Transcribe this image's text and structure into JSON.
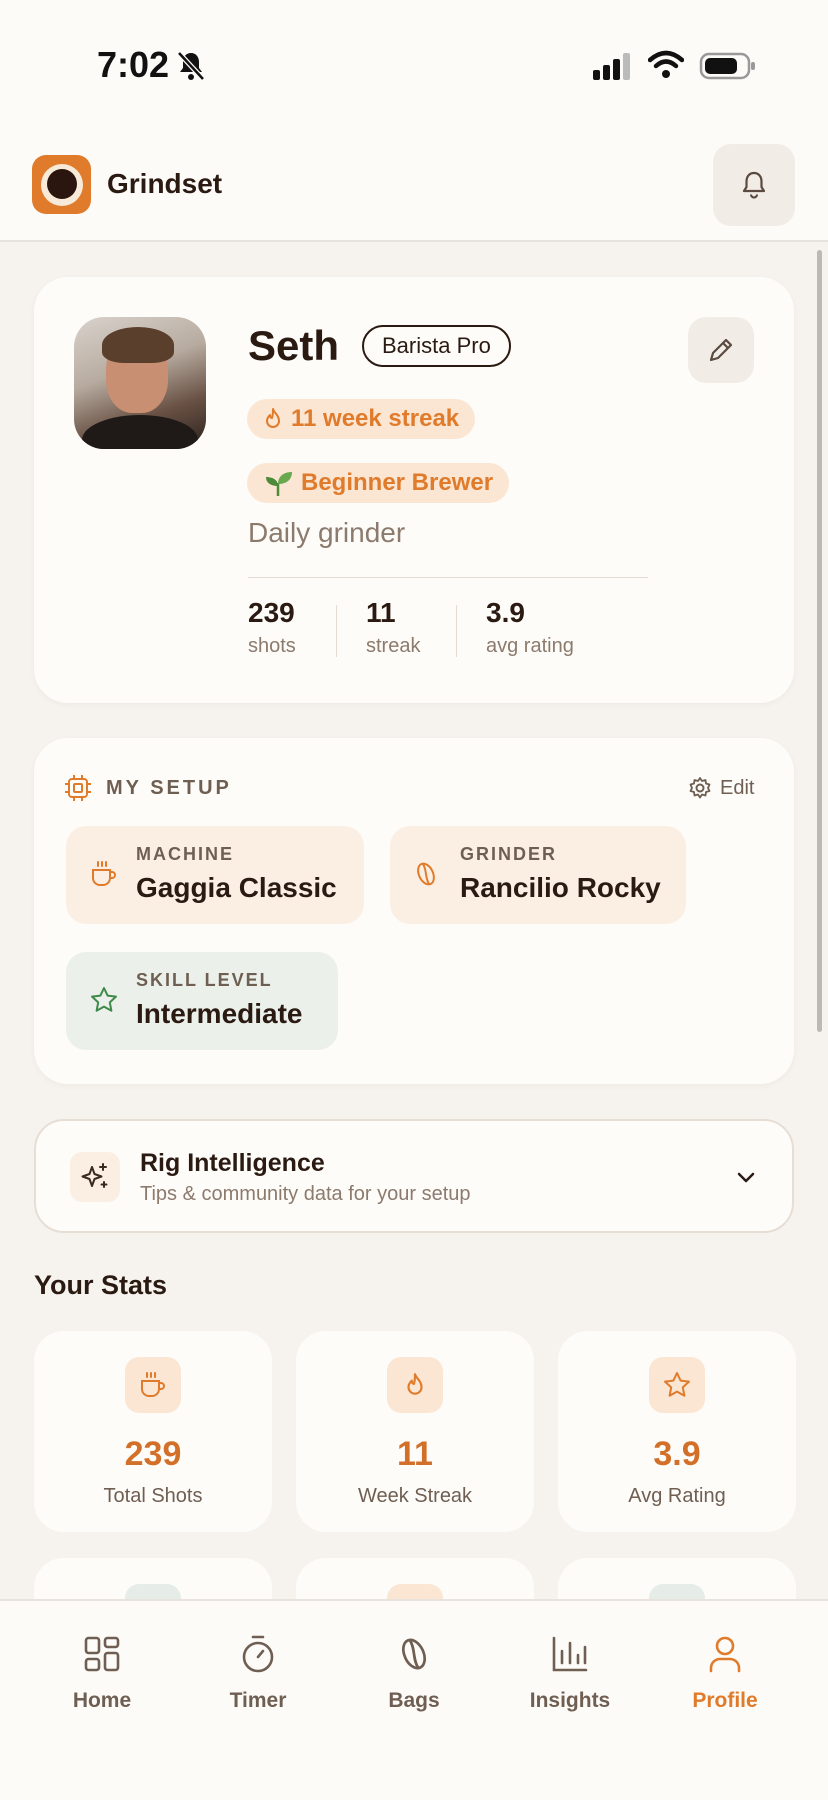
{
  "status_bar": {
    "time": "7:02"
  },
  "app": {
    "name": "Grindset"
  },
  "profile": {
    "name": "Seth",
    "title_badge": "Barista Pro",
    "streak_pill": "11 week streak",
    "level_pill": "Beginner Brewer",
    "tagline": "Daily grinder",
    "mini_stats": [
      {
        "value": "239",
        "label": "shots"
      },
      {
        "value": "11",
        "label": "streak"
      },
      {
        "value": "3.9",
        "label": "avg rating"
      }
    ]
  },
  "setup": {
    "title": "MY SETUP",
    "edit_label": "Edit",
    "machine": {
      "label": "MACHINE",
      "value": "Gaggia Classic"
    },
    "grinder": {
      "label": "GRINDER",
      "value": "Rancilio Rocky"
    },
    "skill": {
      "label": "SKILL LEVEL",
      "value": "Intermediate"
    }
  },
  "rig": {
    "title": "Rig Intelligence",
    "subtitle": "Tips & community data for your setup"
  },
  "stats": {
    "section_title": "Your Stats",
    "cards": [
      {
        "value": "239",
        "label": "Total Shots",
        "icon": "coffee-cup-icon"
      },
      {
        "value": "11",
        "label": "Week Streak",
        "icon": "flame-icon"
      },
      {
        "value": "3.9",
        "label": "Avg Rating",
        "icon": "star-icon"
      }
    ]
  },
  "tabs": [
    {
      "label": "Home",
      "icon": "grid-icon"
    },
    {
      "label": "Timer",
      "icon": "timer-icon"
    },
    {
      "label": "Bags",
      "icon": "bean-icon"
    },
    {
      "label": "Insights",
      "icon": "bar-chart-icon"
    },
    {
      "label": "Profile",
      "icon": "person-icon",
      "active": true
    }
  ],
  "colors": {
    "accent": "#e07b2b",
    "text": "#2a1a12",
    "muted": "#8c7a6d",
    "background": "#f6f3ef",
    "green": "#3f8a4a"
  }
}
